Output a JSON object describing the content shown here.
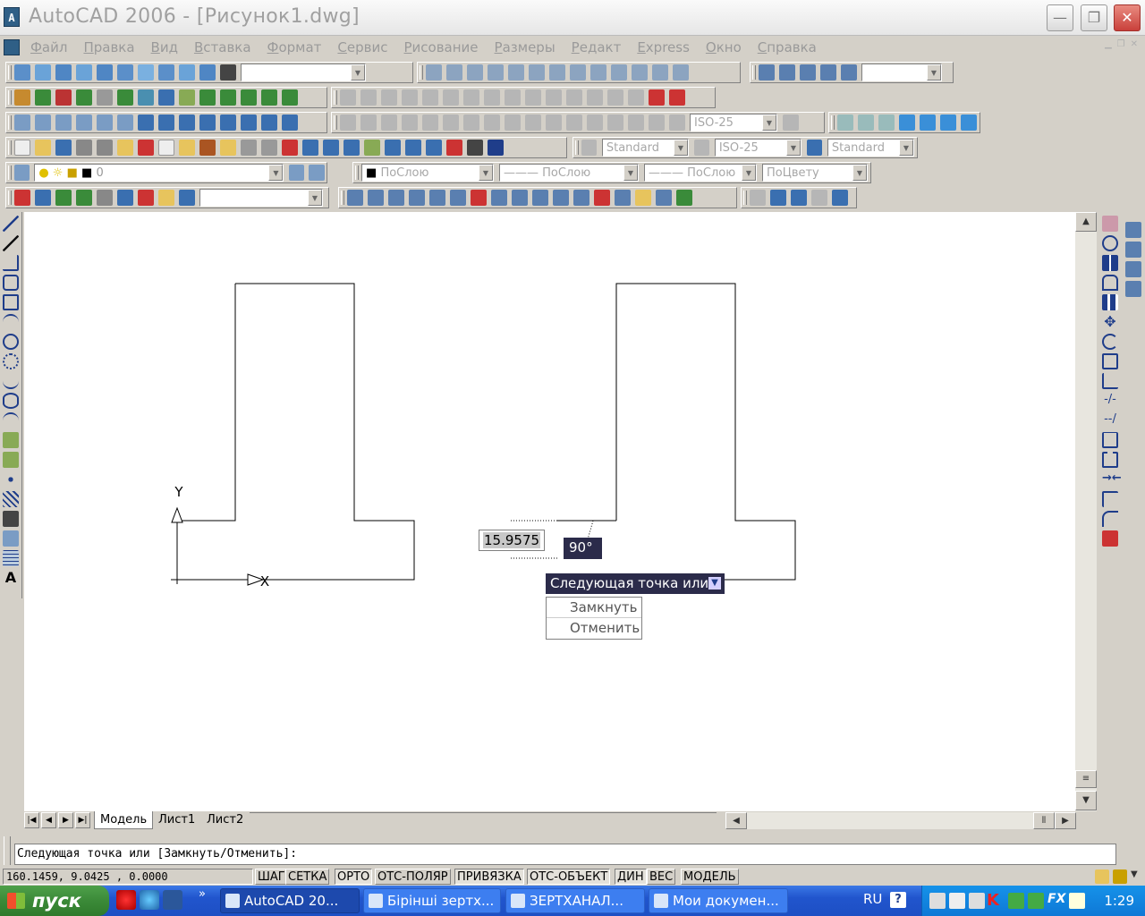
{
  "window": {
    "title": "AutoCAD 2006 - [Рисунок1.dwg]",
    "app_icon_label": "A",
    "min": "—",
    "max": "❐",
    "close": "✕"
  },
  "menu": [
    "Файл",
    "Правка",
    "Вид",
    "Вставка",
    "Формат",
    "Сервис",
    "Рисование",
    "Размеры",
    "Редакт",
    "Express",
    "Окно",
    "Справка"
  ],
  "toolbars": {
    "dimstyle_1": "ISO-25",
    "textstyle": "Standard",
    "dimstyle_2": "ISO-25",
    "tablestyle": "Standard",
    "layer": "0",
    "color": "ПоСлою",
    "linetype": "ПоСлою",
    "lineweight": "ПоСлою",
    "plotstyle": "ПоЦвету"
  },
  "canvas": {
    "ucs_x_label": "X",
    "ucs_y_label": "Y",
    "dyn_input_value": "15.9575",
    "dyn_angle_value": "90°",
    "prompt": {
      "text": "Следующая точка или",
      "icon": "down-arrow-icon"
    },
    "options": [
      "Замкнуть",
      "Отменить"
    ]
  },
  "layout_tabs": [
    "Модель",
    "Лист1",
    "Лист2"
  ],
  "command_line": "Следующая точка или [Замкнуть/Отменить]:",
  "status": {
    "coords": "160.1459, 9.0425 , 0.0000",
    "toggles": [
      {
        "label": "ШАГ",
        "on": false
      },
      {
        "label": "СЕТКА",
        "on": false
      },
      {
        "label": "ОРТО",
        "on": true
      },
      {
        "label": "ОТС-ПОЛЯР",
        "on": false
      },
      {
        "label": "ПРИВЯЗКА",
        "on": true
      },
      {
        "label": "ОТС-ОБЪЕКТ",
        "on": true
      },
      {
        "label": "ДИН",
        "on": true
      },
      {
        "label": "ВЕС",
        "on": false
      },
      {
        "label": "МОДЕЛЬ",
        "on": false
      }
    ]
  },
  "taskbar": {
    "start": "пуск",
    "tasks": [
      "AutoCAD 20...",
      "Бірінші зертх...",
      "ЗЕРТХАНАЛ...",
      "Мои докумен..."
    ],
    "language": "RU",
    "clock": "1:29"
  },
  "colors": {
    "canvas_bg": "#ffffff",
    "ui_bg": "#d4d0c8",
    "taskbar": "#2155cd",
    "tooltip_dark": "#2b2b4a",
    "close_red": "#c9403b"
  }
}
